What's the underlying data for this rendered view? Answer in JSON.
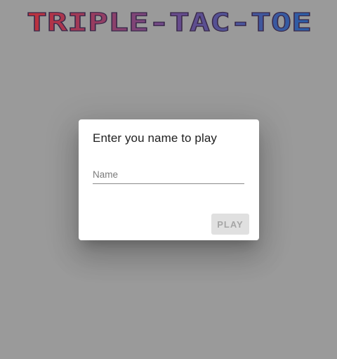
{
  "app": {
    "logo_text": "TRIPLE-TAC-TOE",
    "logo_gradient": [
      "#c0303a",
      "#6a4a8a",
      "#2a5ea8"
    ]
  },
  "dialog": {
    "title": "Enter you name to play",
    "name_field": {
      "placeholder": "Name",
      "value": ""
    },
    "play_label": "PLAY",
    "play_enabled": false
  },
  "colors": {
    "overlay": "#9a9a9a",
    "dialog_bg": "#ffffff",
    "button_disabled_bg": "#e0e0e0",
    "button_disabled_text": "#a6a6a6"
  }
}
